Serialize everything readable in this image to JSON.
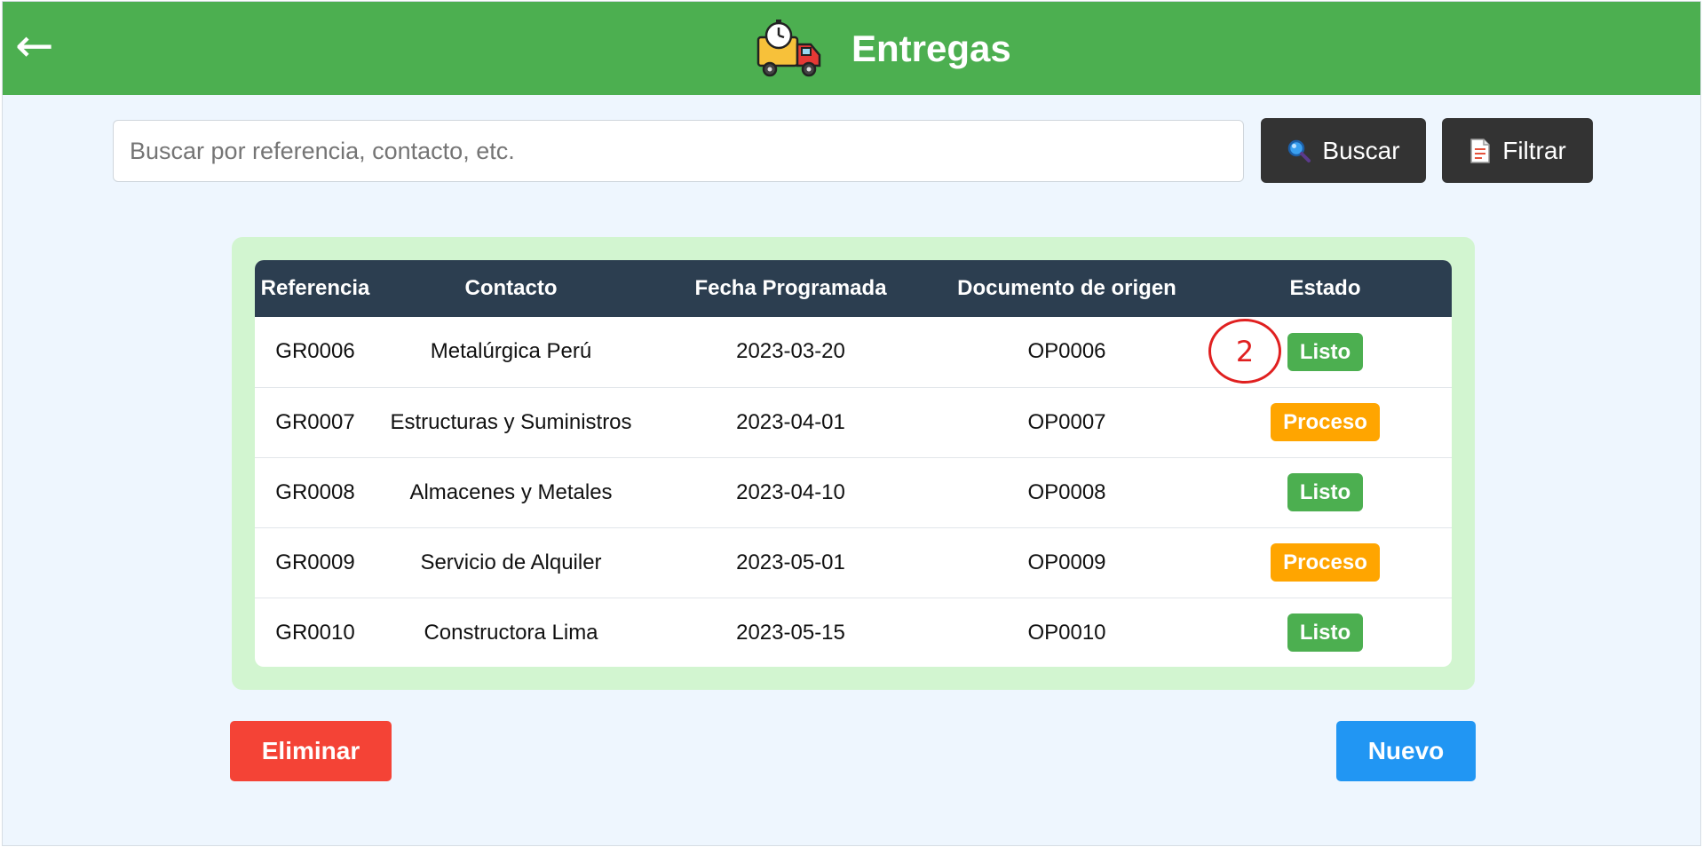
{
  "header": {
    "back_label": "←",
    "icon": "delivery-truck-icon",
    "title": "Entregas",
    "background": "#4caf50"
  },
  "search": {
    "placeholder": "Buscar por referencia, contacto, etc.",
    "value": "",
    "search_button_label": "Buscar",
    "search_button_icon": "magnifier-icon",
    "filter_button_label": "Filtrar",
    "filter_button_icon": "document-icon"
  },
  "table": {
    "columns": [
      "Referencia",
      "Contacto",
      "Fecha Programada",
      "Documento de origen",
      "Estado"
    ],
    "rows": [
      {
        "referencia": "GR0006",
        "contacto": "Metalúrgica Perú",
        "fecha": "2023-03-20",
        "documento": "OP0006",
        "estado": "Listo"
      },
      {
        "referencia": "GR0007",
        "contacto": "Estructuras y Suministros",
        "fecha": "2023-04-01",
        "documento": "OP0007",
        "estado": "Proceso"
      },
      {
        "referencia": "GR0008",
        "contacto": "Almacenes y Metales",
        "fecha": "2023-04-10",
        "documento": "OP0008",
        "estado": "Listo"
      },
      {
        "referencia": "GR0009",
        "contacto": "Servicio de Alquiler",
        "fecha": "2023-05-01",
        "documento": "OP0009",
        "estado": "Proceso"
      },
      {
        "referencia": "GR0010",
        "contacto": "Constructora Lima",
        "fecha": "2023-05-15",
        "documento": "OP0010",
        "estado": "Listo"
      }
    ],
    "status_colors": {
      "Listo": "#4caf50",
      "Proceso": "#ffa500"
    }
  },
  "annotation": {
    "label": "2",
    "color": "#e02020"
  },
  "actions": {
    "delete_label": "Eliminar",
    "delete_color": "#f44336",
    "new_label": "Nuevo",
    "new_color": "#2196f3"
  }
}
